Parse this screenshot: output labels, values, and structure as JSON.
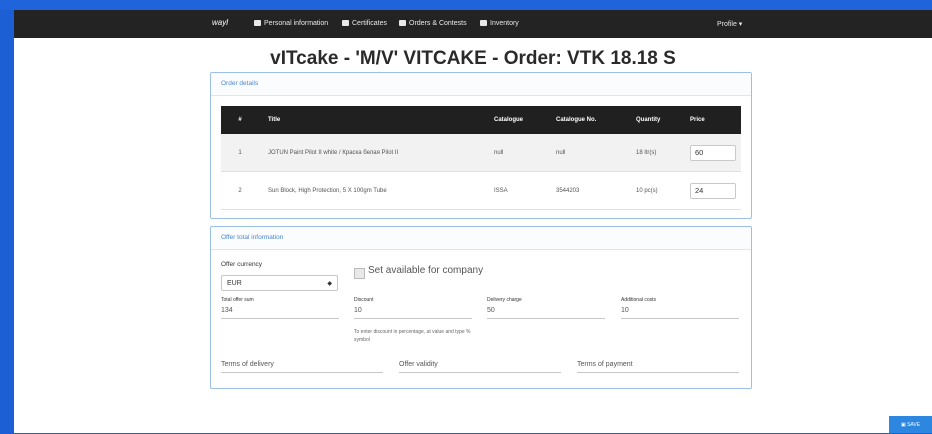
{
  "navbar": {
    "brand": "wayl",
    "items": [
      {
        "label": "Personal information",
        "icon": "id-card-icon"
      },
      {
        "label": "Certificates",
        "icon": "certificate-icon"
      },
      {
        "label": "Orders & Contests",
        "icon": "orders-icon"
      },
      {
        "label": "Inventory",
        "icon": "inventory-icon"
      }
    ],
    "profile": "Profile ▾"
  },
  "page": {
    "title": "vITcake - 'M/V' VITCAKE - Order: VTK 18.18 S"
  },
  "order_details": {
    "heading": "Order details",
    "columns": [
      "#",
      "Title",
      "Catalogue",
      "Catalogue No.",
      "Quantity",
      "Price"
    ],
    "rows": [
      {
        "num": "1",
        "title": "JOTUN Paint Pilot II white / Краска белая Pilot II",
        "catalogue": "null",
        "catalogue_no": "null",
        "quantity": "18 ltr(s)",
        "price": "60"
      },
      {
        "num": "2",
        "title": "Sun Block, High Protection, 5 X 100gm Tube",
        "catalogue": "ISSA",
        "catalogue_no": "3544203",
        "quantity": "10 pc(s)",
        "price": "24"
      }
    ]
  },
  "offer": {
    "heading": "Offer total information",
    "currency_label": "Offer currency",
    "currency_value": "EUR",
    "available_label": "Set available for company",
    "total_label": "Total offer sum",
    "total_value": "134",
    "discount_label": "Discount",
    "discount_value": "10",
    "delivery_label": "Delivery charge",
    "delivery_value": "50",
    "additional_label": "Additional costs",
    "additional_value": "10",
    "discount_note": "To enter discount in percentage, at value and type % symbol",
    "terms_delivery": "Terms of delivery",
    "offer_validity": "Offer validity",
    "terms_payment": "Terms of payment"
  },
  "actions": {
    "save_label": "SAVE"
  },
  "colors": {
    "background": "#1c5fd4",
    "navbar": "#232323",
    "accent": "#4a86d4",
    "save": "#2d86e0"
  }
}
